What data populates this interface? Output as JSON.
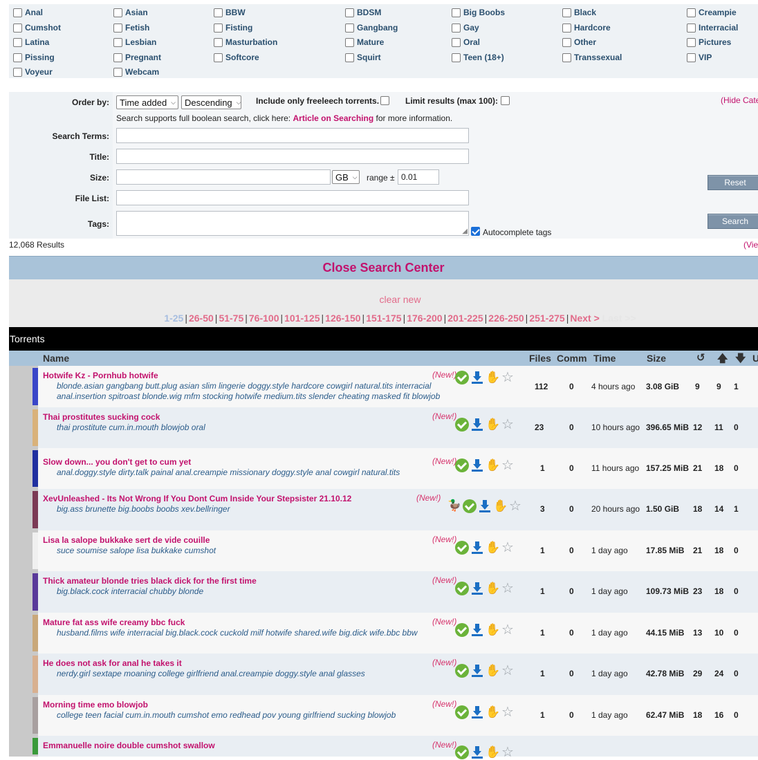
{
  "categories": [
    [
      "Anal",
      "Asian",
      "BBW",
      "BDSM",
      "Big Boobs",
      "Black",
      "Creampie"
    ],
    [
      "Cumshot",
      "Fetish",
      "Fisting",
      "Gangbang",
      "Gay",
      "Hardcore",
      "Interracial"
    ],
    [
      "Latina",
      "Lesbian",
      "Masturbation",
      "Mature",
      "Oral",
      "Other",
      "Pictures"
    ],
    [
      "Pissing",
      "Pregnant",
      "Softcore",
      "Squirt",
      "Teen (18+)",
      "Transsexual",
      "VIP"
    ],
    [
      "Voyeur",
      "Webcam"
    ]
  ],
  "search": {
    "order_by_label": "Order by:",
    "order_by_value": "Time added",
    "order_dir_value": "Descending",
    "freeleech_label": "Include only freeleech torrents.",
    "limit_label": "Limit results (max 100):",
    "hide_link": "(Hide Cate",
    "boolean_prefix": "Search supports full boolean search, click here:",
    "boolean_link": "Article on Searching",
    "boolean_suffix": "for more information.",
    "search_terms_label": "Search Terms:",
    "title_label": "Title:",
    "size_label": "Size:",
    "size_unit": "GB",
    "range_label": "range ±",
    "range_value": "0.01",
    "file_list_label": "File List:",
    "tags_label": "Tags:",
    "autocomplete_label": "Autocomplete tags",
    "reset_button": "Reset",
    "search_button": "Search",
    "results_count": "12,068 Results",
    "view_link": "(Vie"
  },
  "close_search": "Close Search Center",
  "clear_new": "clear new",
  "pager": {
    "pages": [
      "1-25",
      "26-50",
      "51-75",
      "76-100",
      "101-125",
      "126-150",
      "151-175",
      "176-200",
      "201-225",
      "226-250",
      "251-275"
    ],
    "next": "Next >",
    "last": "Last >>"
  },
  "torrents_title": "Torrents",
  "headers": {
    "name": "Name",
    "files": "Files",
    "comm": "Comm",
    "time": "Time",
    "size": "Size",
    "snatched_icon": "refresh-icon",
    "seeders_icon": "arrow-up-icon",
    "leechers_icon": "arrow-down-icon",
    "uploader_cut": "U"
  },
  "rows": [
    {
      "name": "Hotwife Kz - Pornhub hotwife",
      "tags": "blonde.asian gangbang butt.plug asian slim lingerie doggy.style hardcore cowgirl natural.tits interracial anal.insertion spitroast blonde.wig mfm stocking hotwife medium.tits slender cheating masked fit blowjob",
      "new": "(New!)",
      "files": "112",
      "comm": "0",
      "time": "4 hours ago",
      "size": "3.08 GiB",
      "snatched": "9",
      "seeders": "9",
      "leechers": "1",
      "gold_hand": true,
      "duck": false
    },
    {
      "name": "Thai prostitutes sucking cock",
      "tags": "thai prostitute cum.in.mouth blowjob oral",
      "new": "(New!)",
      "files": "23",
      "comm": "0",
      "time": "10 hours ago",
      "size": "396.65 MiB",
      "snatched": "12",
      "seeders": "11",
      "leechers": "0",
      "gold_hand": false,
      "duck": false
    },
    {
      "name": "Slow down... you don't get to cum yet",
      "tags": "anal.doggy.style dirty.talk painal anal.creampie missionary doggy.style anal cowgirl natural.tits",
      "new": "(New!)",
      "files": "1",
      "comm": "0",
      "time": "11 hours ago",
      "size": "157.25 MiB",
      "snatched": "21",
      "seeders": "18",
      "leechers": "0",
      "gold_hand": false,
      "duck": false
    },
    {
      "name": "XevUnleashed - Its Not Wrong If You Dont Cum Inside Your Stepsister 21.10.12",
      "tags": "big.ass brunette big.boobs boobs xev.bellringer",
      "new": "(New!)",
      "files": "3",
      "comm": "0",
      "time": "20 hours ago",
      "size": "1.50 GiB",
      "snatched": "18",
      "seeders": "14",
      "leechers": "1",
      "gold_hand": false,
      "duck": true
    },
    {
      "name": "Lisa la salope bukkake sert de vide couille",
      "tags": "suce soumise salope lisa bukkake cumshot",
      "new": "(New!)",
      "files": "1",
      "comm": "0",
      "time": "1 day ago",
      "size": "17.85 MiB",
      "snatched": "21",
      "seeders": "18",
      "leechers": "0",
      "gold_hand": false,
      "duck": false
    },
    {
      "name": "Thick amateur blonde tries black dick for the first time",
      "tags": "big.black.cock interracial chubby blonde",
      "new": "(New!)",
      "files": "1",
      "comm": "0",
      "time": "1 day ago",
      "size": "109.73 MiB",
      "snatched": "23",
      "seeders": "18",
      "leechers": "0",
      "gold_hand": false,
      "duck": false
    },
    {
      "name": "Mature fat ass wife creamy bbc fuck",
      "tags": "husband.films wife interracial big.black.cock cuckold milf hotwife shared.wife big.dick wife.bbc bbw",
      "new": "(New!)",
      "files": "1",
      "comm": "0",
      "time": "1 day ago",
      "size": "44.15 MiB",
      "snatched": "13",
      "seeders": "10",
      "leechers": "0",
      "gold_hand": false,
      "duck": false
    },
    {
      "name": "He does not ask for anal he takes it",
      "tags": "nerdy.girl sextape moaning college girlfriend anal.creampie doggy.style anal glasses",
      "new": "(New!)",
      "files": "1",
      "comm": "0",
      "time": "1 day ago",
      "size": "42.78 MiB",
      "snatched": "29",
      "seeders": "24",
      "leechers": "0",
      "gold_hand": false,
      "duck": false
    },
    {
      "name": "Morning time emo blowjob",
      "tags": "college teen facial cum.in.mouth cumshot emo redhead pov young girlfriend sucking blowjob",
      "new": "(New!)",
      "files": "1",
      "comm": "0",
      "time": "1 day ago",
      "size": "62.47 MiB",
      "snatched": "18",
      "seeders": "16",
      "leechers": "0",
      "gold_hand": false,
      "duck": false
    },
    {
      "name": "Emmanuelle noire double cumshot swallow",
      "tags": "",
      "new": "(New!)",
      "files": "",
      "comm": "",
      "time": "",
      "size": "",
      "snatched": "",
      "seeders": "",
      "leechers": "",
      "gold_hand": false,
      "duck": false
    }
  ],
  "colors": {
    "accent_pink": "#c2126d",
    "tag_blue": "#2b5c8a",
    "header_blue": "#a9c3d9",
    "button": "#7e93a8"
  }
}
